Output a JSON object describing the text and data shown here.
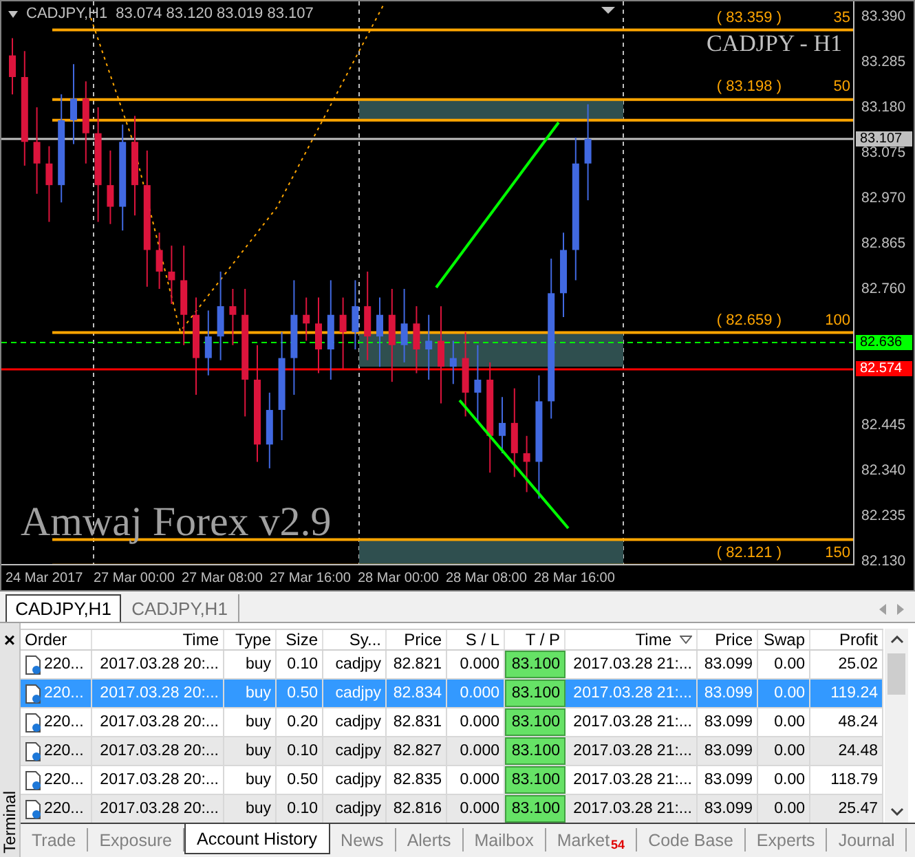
{
  "chart": {
    "symbol": "CADJPY,H1",
    "quote": "83.074 83.120 83.019 83.107",
    "title": "CADJPY - H1",
    "watermark": "Amwaj Forex v2.9",
    "levels": [
      {
        "label": "( 83.359 )",
        "number": "35"
      },
      {
        "label": "( 83.198 )",
        "number": "50"
      },
      {
        "label": "( 82.659 )",
        "number": "100"
      },
      {
        "label": "( 82.121 )",
        "number": "150"
      }
    ],
    "price_ticks": [
      "83.390",
      "83.285",
      "83.180",
      "83.075",
      "82.970",
      "82.865",
      "82.760",
      "82.445",
      "82.340",
      "82.235",
      "82.130"
    ],
    "price_tags": [
      {
        "price": "83.107",
        "color": "#c0c0c0",
        "kind": "last"
      },
      {
        "price": "82.636",
        "color": "#00ff00",
        "kind": "bid"
      },
      {
        "price": "82.574",
        "color": "#ff0000",
        "kind": "ask"
      }
    ],
    "time_ticks": [
      "24 Mar 2017",
      "27 Mar 00:00",
      "27 Mar 08:00",
      "27 Mar 16:00",
      "28 Mar 00:00",
      "28 Mar 08:00",
      "28 Mar 16:00"
    ]
  },
  "chart_tabs": [
    {
      "label": "CADJPY,H1",
      "selected": true
    },
    {
      "label": "CADJPY,H1",
      "selected": false
    }
  ],
  "terminal": {
    "title": "Terminal",
    "close": "×",
    "columns": [
      {
        "label": "Order",
        "sorted": false,
        "highlighted": false
      },
      {
        "label": "Time",
        "sorted": false,
        "highlighted": false
      },
      {
        "label": "Type",
        "sorted": false,
        "highlighted": false
      },
      {
        "label": "Size",
        "sorted": false,
        "highlighted": false
      },
      {
        "label": "Sy...",
        "sorted": false,
        "highlighted": false
      },
      {
        "label": "Price",
        "sorted": false,
        "highlighted": false
      },
      {
        "label": "S / L",
        "sorted": false,
        "highlighted": false
      },
      {
        "label": "T / P",
        "sorted": false,
        "highlighted": true
      },
      {
        "label": "Time",
        "sorted": true,
        "highlighted": false
      },
      {
        "label": "Price",
        "sorted": false,
        "highlighted": false
      },
      {
        "label": "Swap",
        "sorted": false,
        "highlighted": false
      },
      {
        "label": "Profit",
        "sorted": false,
        "highlighted": false
      }
    ],
    "rows": [
      {
        "selected": false,
        "cells": [
          "220...",
          "2017.03.28 20:...",
          "buy",
          "0.10",
          "cadjpy",
          "82.821",
          "0.000",
          "83.100",
          "2017.03.28 21:...",
          "83.099",
          "0.00",
          "25.02"
        ]
      },
      {
        "selected": true,
        "cells": [
          "220...",
          "2017.03.28 20:...",
          "buy",
          "0.50",
          "cadjpy",
          "82.834",
          "0.000",
          "83.100",
          "2017.03.28 21:...",
          "83.099",
          "0.00",
          "119.24"
        ]
      },
      {
        "selected": false,
        "cells": [
          "220...",
          "2017.03.28 20:...",
          "buy",
          "0.20",
          "cadjpy",
          "82.831",
          "0.000",
          "83.100",
          "2017.03.28 21:...",
          "83.099",
          "0.00",
          "48.24"
        ]
      },
      {
        "selected": false,
        "cells": [
          "220...",
          "2017.03.28 20:...",
          "buy",
          "0.10",
          "cadjpy",
          "82.827",
          "0.000",
          "83.100",
          "2017.03.28 21:...",
          "83.099",
          "0.00",
          "24.48"
        ]
      },
      {
        "selected": false,
        "cells": [
          "220...",
          "2017.03.28 20:...",
          "buy",
          "0.50",
          "cadjpy",
          "82.835",
          "0.000",
          "83.100",
          "2017.03.28 21:...",
          "83.099",
          "0.00",
          "118.79"
        ]
      },
      {
        "selected": false,
        "cells": [
          "220...",
          "2017.03.28 20:...",
          "buy",
          "0.10",
          "cadjpy",
          "82.816",
          "0.000",
          "83.100",
          "2017.03.28 21:...",
          "83.099",
          "0.00",
          "25.47"
        ]
      }
    ],
    "tabs": [
      {
        "label": "Trade",
        "selected": false
      },
      {
        "label": "Exposure",
        "selected": false
      },
      {
        "label": "Account History",
        "selected": true
      },
      {
        "label": "News",
        "selected": false
      },
      {
        "label": "Alerts",
        "selected": false
      },
      {
        "label": "Mailbox",
        "selected": false
      },
      {
        "label": "Market",
        "selected": false,
        "badge": "54"
      },
      {
        "label": "Code Base",
        "selected": false
      },
      {
        "label": "Experts",
        "selected": false
      },
      {
        "label": "Journal",
        "selected": false
      }
    ]
  }
}
